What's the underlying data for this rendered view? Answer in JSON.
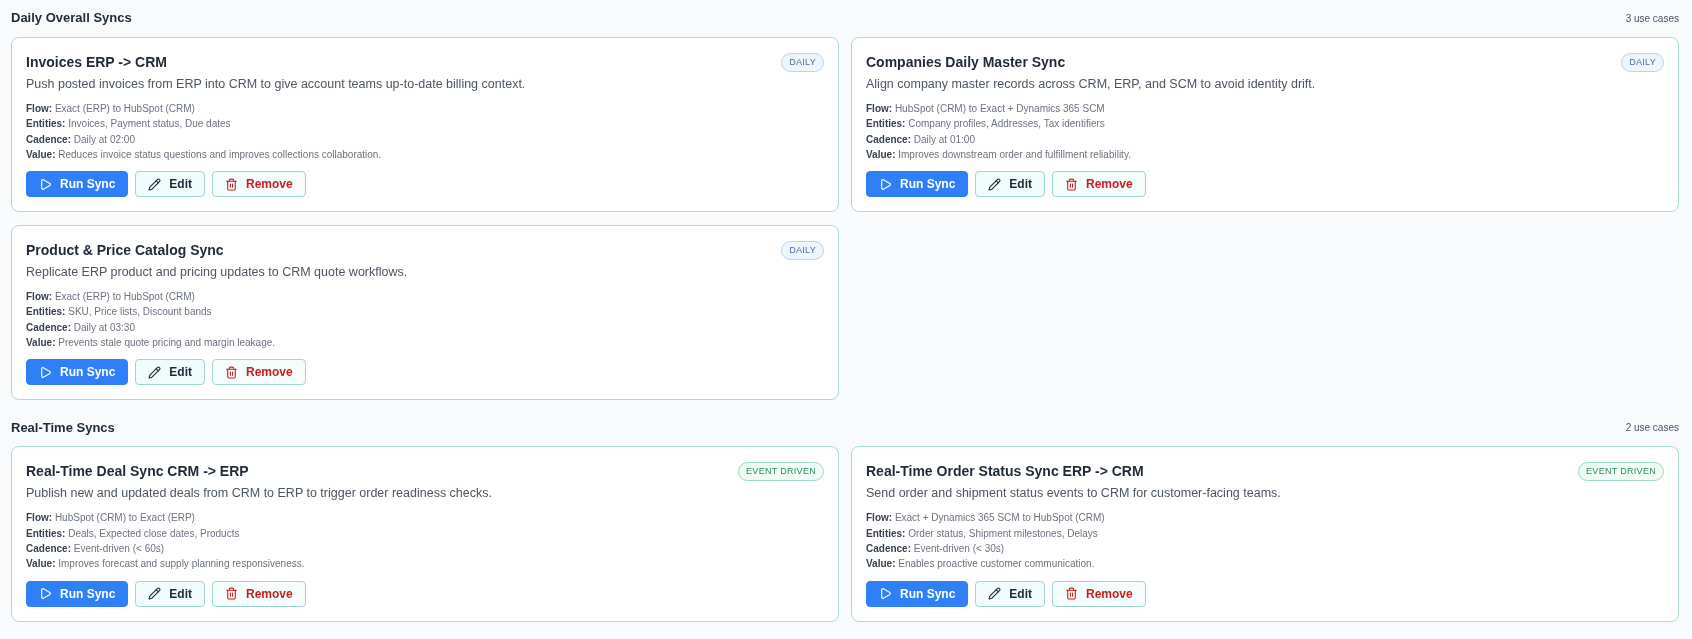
{
  "sections": [
    {
      "title": "Daily Overall Syncs",
      "count": "3 use cases",
      "cards": [
        {
          "title": "Invoices ERP -> CRM",
          "badge": {
            "label": "DAILY",
            "kind": "daily"
          },
          "description": "Push posted invoices from ERP into CRM to give account teams up-to-date billing context.",
          "details": [
            "**Flow:** Exact (ERP) to HubSpot (CRM)",
            "**Entities:** Invoices, Payment status, Due dates",
            "**Cadence:** Daily at 02:00",
            "**Value:** Reduces invoice status questions and improves collections collaboration."
          ],
          "buttons": [
            {
              "label": "Run Sync",
              "kind": "run"
            },
            {
              "label": "Edit",
              "kind": "edit"
            },
            {
              "label": "Remove",
              "kind": "remove"
            }
          ]
        },
        {
          "title": "Companies Daily Master Sync",
          "badge": {
            "label": "DAILY",
            "kind": "daily"
          },
          "description": "Align company master records across CRM, ERP, and SCM to avoid identity drift.",
          "details": [
            "**Flow:** HubSpot (CRM) to Exact + Dynamics 365 SCM",
            "**Entities:** Company profiles, Addresses, Tax identifiers",
            "**Cadence:** Daily at 01:00",
            "**Value:** Improves downstream order and fulfillment reliability."
          ],
          "buttons": [
            {
              "label": "Run Sync",
              "kind": "run"
            },
            {
              "label": "Edit",
              "kind": "edit"
            },
            {
              "label": "Remove",
              "kind": "remove"
            }
          ]
        },
        {
          "title": "Product & Price Catalog Sync",
          "badge": {
            "label": "DAILY",
            "kind": "daily"
          },
          "description": "Replicate ERP product and pricing updates to CRM quote workflows.",
          "details": [
            "**Flow:** Exact (ERP) to HubSpot (CRM)",
            "**Entities:** SKU, Price lists, Discount bands",
            "**Cadence:** Daily at 03:30",
            "**Value:** Prevents stale quote pricing and margin leakage."
          ],
          "buttons": [
            {
              "label": "Run Sync",
              "kind": "run"
            },
            {
              "label": "Edit",
              "kind": "edit"
            },
            {
              "label": "Remove",
              "kind": "remove"
            }
          ]
        }
      ]
    },
    {
      "title": "Real-Time Syncs",
      "count": "2 use cases",
      "cards": [
        {
          "title": "Real-Time Deal Sync CRM -> ERP",
          "badge": {
            "label": "EVENT DRIVEN",
            "kind": "event"
          },
          "description": "Publish new and updated deals from CRM to ERP to trigger order readiness checks.",
          "details": [
            "**Flow:** HubSpot (CRM) to Exact (ERP)",
            "**Entities:** Deals, Expected close dates, Products",
            "**Cadence:** Event-driven (< 60s)",
            "**Value:** Improves forecast and supply planning responsiveness."
          ],
          "buttons": [
            {
              "label": "Run Sync",
              "kind": "run"
            },
            {
              "label": "Edit",
              "kind": "edit"
            },
            {
              "label": "Remove",
              "kind": "remove"
            }
          ]
        },
        {
          "title": "Real-Time Order Status Sync ERP -> CRM",
          "badge": {
            "label": "EVENT DRIVEN",
            "kind": "event"
          },
          "description": "Send order and shipment status events to CRM for customer-facing teams.",
          "details": [
            "**Flow:** Exact + Dynamics 365 SCM to HubSpot (CRM)",
            "**Entities:** Order status, Shipment milestones, Delays",
            "**Cadence:** Event-driven (< 30s)",
            "**Value:** Enables proactive customer communication."
          ],
          "buttons": [
            {
              "label": "Run Sync",
              "kind": "run"
            },
            {
              "label": "Edit",
              "kind": "edit"
            },
            {
              "label": "Remove",
              "kind": "remove"
            }
          ]
        }
      ]
    }
  ]
}
